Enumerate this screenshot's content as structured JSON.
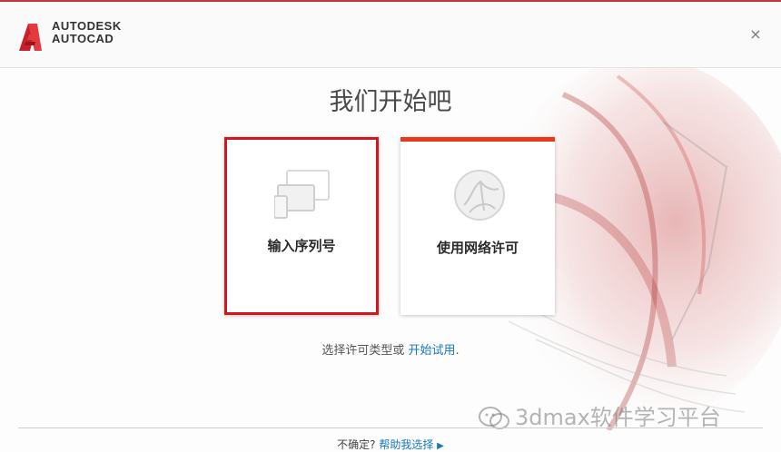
{
  "window": {
    "brand_line1": "AUTODESK",
    "brand_line2": "AUTOCAD",
    "close_glyph": "×",
    "accent_color": "#d4161c"
  },
  "main": {
    "title": "我们开始吧",
    "cards": [
      {
        "label": "输入序列号",
        "icon": "devices-icon",
        "selected": true
      },
      {
        "label": "使用网络许可",
        "icon": "globe-network-icon",
        "selected": false
      }
    ],
    "hint_text": "选择许可类型或",
    "hint_link": "开始试用",
    "hint_suffix": "."
  },
  "footer": {
    "question": "不确定?",
    "help_link": "帮助我选择"
  },
  "watermark": {
    "text": "3dmax软件学习平台"
  }
}
